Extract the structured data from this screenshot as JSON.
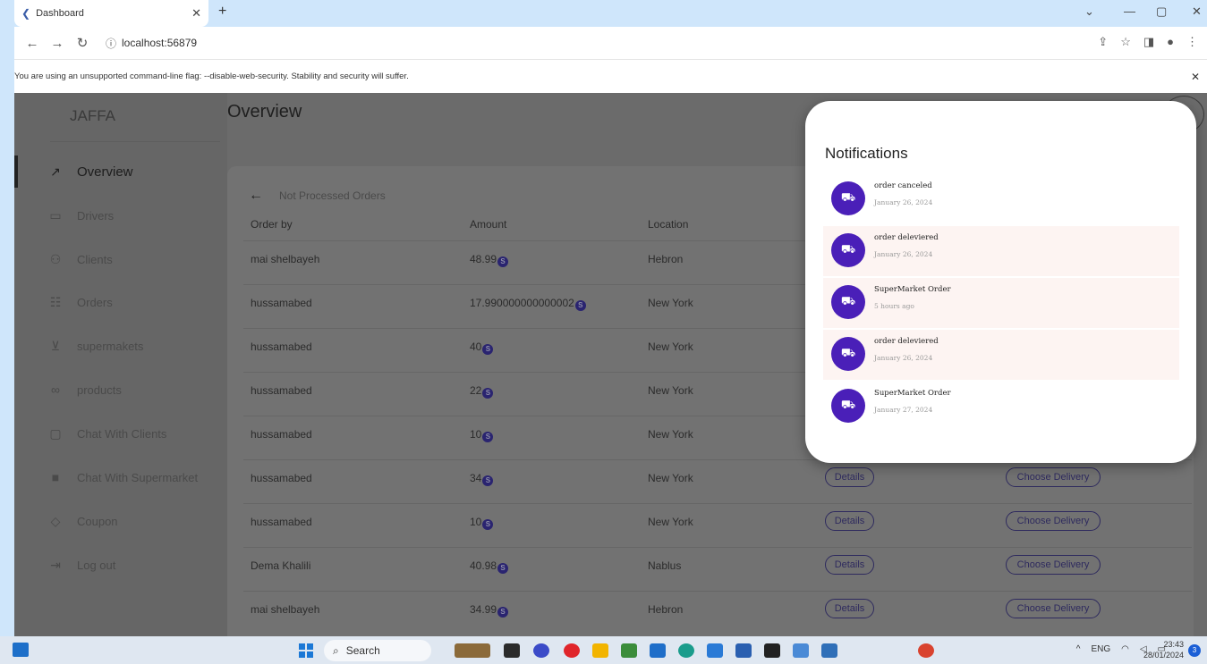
{
  "browser": {
    "tab_title": "Dashboard",
    "url": "localhost:56879",
    "warning": "You are using an unsupported command-line flag: --disable-web-security. Stability and security will suffer."
  },
  "sidebar": {
    "brand": "JAFFA",
    "items": [
      {
        "label": "Overview",
        "icon": "trending-icon"
      },
      {
        "label": "Drivers",
        "icon": "car-icon"
      },
      {
        "label": "Clients",
        "icon": "people-icon"
      },
      {
        "label": "Orders",
        "icon": "inbox-icon"
      },
      {
        "label": "supermakets",
        "icon": "cart-icon"
      },
      {
        "label": "products",
        "icon": "infinity-icon"
      },
      {
        "label": "Chat With Clients",
        "icon": "chat-outline-icon"
      },
      {
        "label": "Chat With Supermarket",
        "icon": "chat-filled-icon"
      },
      {
        "label": "Coupon",
        "icon": "tag-icon"
      },
      {
        "label": "Log out",
        "icon": "logout-icon"
      }
    ]
  },
  "main": {
    "title": "Overview",
    "section": "Not Processed Orders",
    "columns": [
      "Order by",
      "Amount",
      "Location"
    ],
    "details_label": "Details",
    "choose_label": "Choose Delivery",
    "rows": [
      {
        "order_by": "mai shelbayeh",
        "amount": "48.99",
        "location": "Hebron"
      },
      {
        "order_by": "hussamabed",
        "amount": "17.990000000000002",
        "location": "New York"
      },
      {
        "order_by": "hussamabed",
        "amount": "40",
        "location": "New York"
      },
      {
        "order_by": "hussamabed",
        "amount": "22",
        "location": "New York"
      },
      {
        "order_by": "hussamabed",
        "amount": "10",
        "location": "New York"
      },
      {
        "order_by": "hussamabed",
        "amount": "34",
        "location": "New York"
      },
      {
        "order_by": "hussamabed",
        "amount": "10",
        "location": "New York"
      },
      {
        "order_by": "Dema Khalili",
        "amount": "40.98",
        "location": "Nablus"
      },
      {
        "order_by": "mai shelbayeh",
        "amount": "34.99",
        "location": "Hebron"
      }
    ]
  },
  "notifications": {
    "title": "Notifications",
    "items": [
      {
        "text": "order canceled",
        "time": "January 26, 2024"
      },
      {
        "text": "order deleviered",
        "time": "January 26, 2024"
      },
      {
        "text": "SuperMarket Order",
        "time": "5 hours ago"
      },
      {
        "text": "order deleviered",
        "time": "January 26, 2024"
      },
      {
        "text": "SuperMarket Order",
        "time": "January 27, 2024"
      }
    ]
  },
  "taskbar": {
    "search": "Search",
    "lang": "ENG",
    "time": "23:43",
    "date": "28/01/2024",
    "badge": "3"
  }
}
